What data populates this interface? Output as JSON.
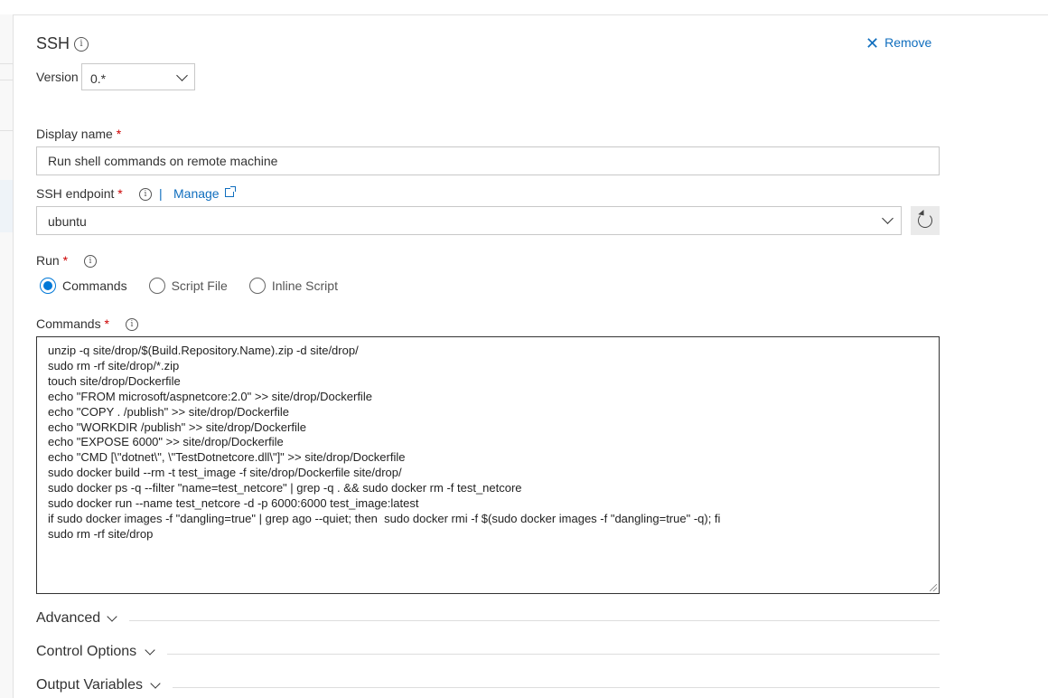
{
  "task": {
    "title": "SSH",
    "remove_label": "Remove"
  },
  "version": {
    "label": "Version",
    "value": "0.*"
  },
  "display_name": {
    "label": "Display name",
    "required_mark": "*",
    "value": "Run shell commands on remote machine"
  },
  "ssh_endpoint": {
    "label": "SSH endpoint",
    "required_mark": "*",
    "separator": "|",
    "manage_label": "Manage",
    "value": "ubuntu"
  },
  "run": {
    "label": "Run",
    "required_mark": "*",
    "options": [
      "Commands",
      "Script File",
      "Inline Script"
    ],
    "selected": "Commands"
  },
  "commands": {
    "label": "Commands",
    "required_mark": "*",
    "value": "unzip -q site/drop/$(Build.Repository.Name).zip -d site/drop/\nsudo rm -rf site/drop/*.zip\ntouch site/drop/Dockerfile\necho \"FROM microsoft/aspnetcore:2.0\" >> site/drop/Dockerfile\necho \"COPY . /publish\" >> site/drop/Dockerfile\necho \"WORKDIR /publish\" >> site/drop/Dockerfile\necho \"EXPOSE 6000\" >> site/drop/Dockerfile\necho \"CMD [\\\"dotnet\\\", \\\"TestDotnetcore.dll\\\"]\" >> site/drop/Dockerfile\nsudo docker build --rm -t test_image -f site/drop/Dockerfile site/drop/\nsudo docker ps -q --filter \"name=test_netcore\" | grep -q . && sudo docker rm -f test_netcore\nsudo docker run --name test_netcore -d -p 6000:6000 test_image:latest\nif sudo docker images -f \"dangling=true\" | grep ago --quiet; then  sudo docker rmi -f $(sudo docker images -f \"dangling=true\" -q); fi\nsudo rm -rf site/drop"
  },
  "sections": {
    "advanced": "Advanced",
    "control_options": "Control Options",
    "output_variables": "Output Variables"
  },
  "icons": {
    "info": "info-icon",
    "close": "close-icon",
    "external_link": "external-link-icon",
    "refresh": "refresh-icon",
    "chevron": "chevron-down-icon"
  },
  "colors": {
    "accent": "#0078d7",
    "link": "#106ebe",
    "required": "#c00000"
  }
}
